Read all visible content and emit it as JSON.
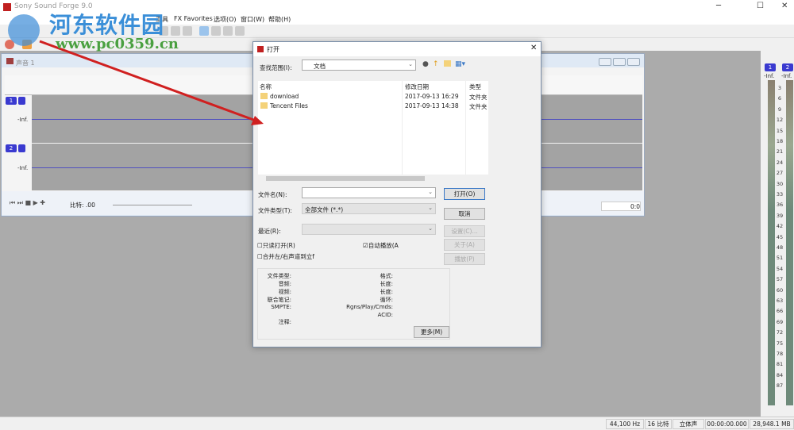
{
  "app": {
    "title": "Sony Sound Forge 9.0",
    "min": "─",
    "max": "☐",
    "close": "✕"
  },
  "menu": [
    "工具",
    "FX Favorites",
    "选项(O)",
    "窗口(W)",
    "帮助(H)"
  ],
  "document": {
    "title": "声音 1",
    "ch1": "1",
    "ch2": "2",
    "inf": "-Inf.",
    "rate_label": "比特: .00",
    "time": "0:0"
  },
  "dialog": {
    "title": "打开",
    "lookin_label": "查找范围(I):",
    "lookin_value": "文档",
    "columns": [
      "名称",
      "修改日期",
      "类型"
    ],
    "files": [
      {
        "name": "download",
        "date": "2017-09-13 16:29",
        "type": "文件夹"
      },
      {
        "name": "Tencent Files",
        "date": "2017-09-13 14:38",
        "type": "文件夹"
      }
    ],
    "filename_label": "文件名(N):",
    "filename_value": "",
    "filetype_label": "文件类型(T):",
    "filetype_value": "全部文件 (*.*)",
    "recent_label": "最近(R):",
    "readonly_label": "只读打开(R)",
    "autoplay_label": "自动播放(A",
    "merge_label": "合并左/右声道到立f",
    "open_btn": "打开(O)",
    "cancel_btn": "取消",
    "settings_btn": "设置(C)...",
    "about_btn": "关于(A)",
    "play_btn": "播放(P)",
    "more_btn": "更多(M)",
    "info_left": [
      "文件类型:",
      "音频:",
      "视频:",
      "联合笔记:",
      "SMPTE:",
      "",
      "注释:"
    ],
    "info_right": [
      "格式:",
      "长度:",
      "长度:",
      "循环:",
      "Rgns/Play/Cmds:",
      "ACID:"
    ]
  },
  "meter": {
    "ch1": "1",
    "ch2": "2",
    "inf": "-Inf.",
    "ticks": [
      "3",
      "6",
      "9",
      "12",
      "15",
      "18",
      "21",
      "24",
      "27",
      "30",
      "33",
      "36",
      "39",
      "42",
      "45",
      "48",
      "51",
      "54",
      "57",
      "60",
      "63",
      "66",
      "69",
      "72",
      "75",
      "78",
      "81",
      "84",
      "87"
    ]
  },
  "status": [
    "44,100 Hz",
    "16 比特",
    "立体声",
    "00:00:00.000",
    "28,948.1 MB"
  ],
  "watermark": {
    "name": "河东软件园",
    "url": "www.pc0359.cn"
  }
}
